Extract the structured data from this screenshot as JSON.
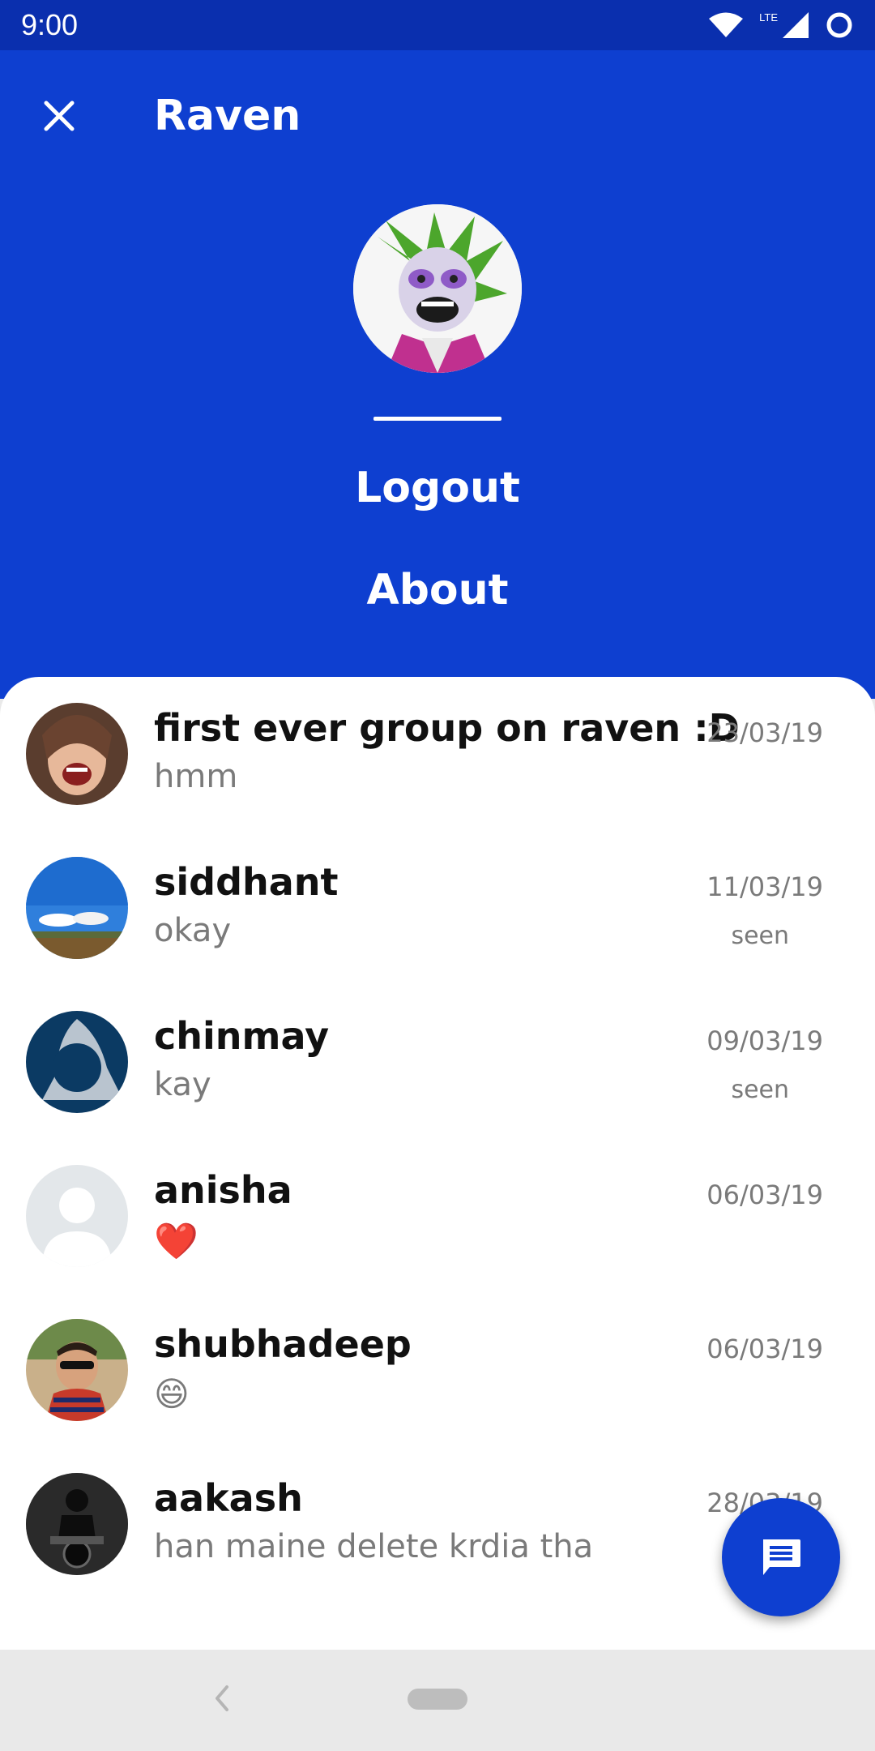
{
  "status_bar": {
    "time": "9:00",
    "network_label": "LTE",
    "icons": [
      "wifi-icon",
      "signal-icon",
      "circle-icon"
    ]
  },
  "header": {
    "title": "Raven",
    "close_icon": "close-icon",
    "menu": {
      "logout_label": "Logout",
      "about_label": "About"
    },
    "colors": {
      "primary": "#0e3fd0",
      "status_bar": "#0a2fae"
    }
  },
  "chats": [
    {
      "name": "first ever group on raven :D",
      "message": "hmm",
      "date": "23/03/19",
      "status": ""
    },
    {
      "name": "siddhant",
      "message": "okay",
      "date": "11/03/19",
      "status": "seen"
    },
    {
      "name": "chinmay",
      "message": "kay",
      "date": "09/03/19",
      "status": "seen"
    },
    {
      "name": "anisha",
      "message": "❤️",
      "date": "06/03/19",
      "status": ""
    },
    {
      "name": "shubhadeep",
      "message": "😄",
      "date": "06/03/19",
      "status": ""
    },
    {
      "name": "aakash",
      "message": "han maine delete krdia tha",
      "date": "28/03/19",
      "status": ""
    }
  ],
  "fab": {
    "icon": "message-icon"
  },
  "nav_bar": {
    "icons": [
      "back-icon",
      "home-pill"
    ]
  }
}
